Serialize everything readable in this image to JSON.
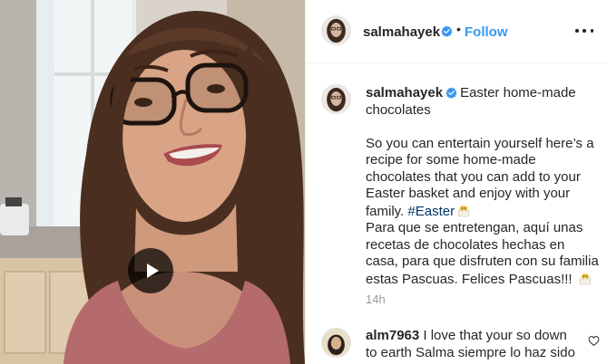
{
  "post": {
    "author": "salmahayek",
    "follow_label": "Follow",
    "separator": "•",
    "caption": {
      "title": "Easter home-made chocolates",
      "english_text": "So you can entertain yourself here’s a recipe for some home-made chocolates that you can add to your Easter basket and enjoy with your family.",
      "hashtag": "#Easter",
      "spanish_text": "Para que se entretengan, aquí unas recetas de chocolates hechas en casa, para que disfruten con su familia estas Pascuas. Felices Pascuas!!!"
    },
    "timestamp": "14h",
    "media_type": "video"
  },
  "comments": [
    {
      "username": "alm7963",
      "text": "I love that your so down to earth Salma siempre lo haz sido"
    }
  ],
  "colors": {
    "follow_blue": "#3897f0",
    "hashtag": "#003569",
    "verified_badge": "#3897f0",
    "muted_text": "#999999",
    "divider": "#efefef"
  },
  "icons": {
    "verified": "verified-badge-icon",
    "more": "more-options-icon",
    "play": "play-icon",
    "heart": "heart-outline-icon",
    "emoji": "hatching-chick-emoji"
  }
}
